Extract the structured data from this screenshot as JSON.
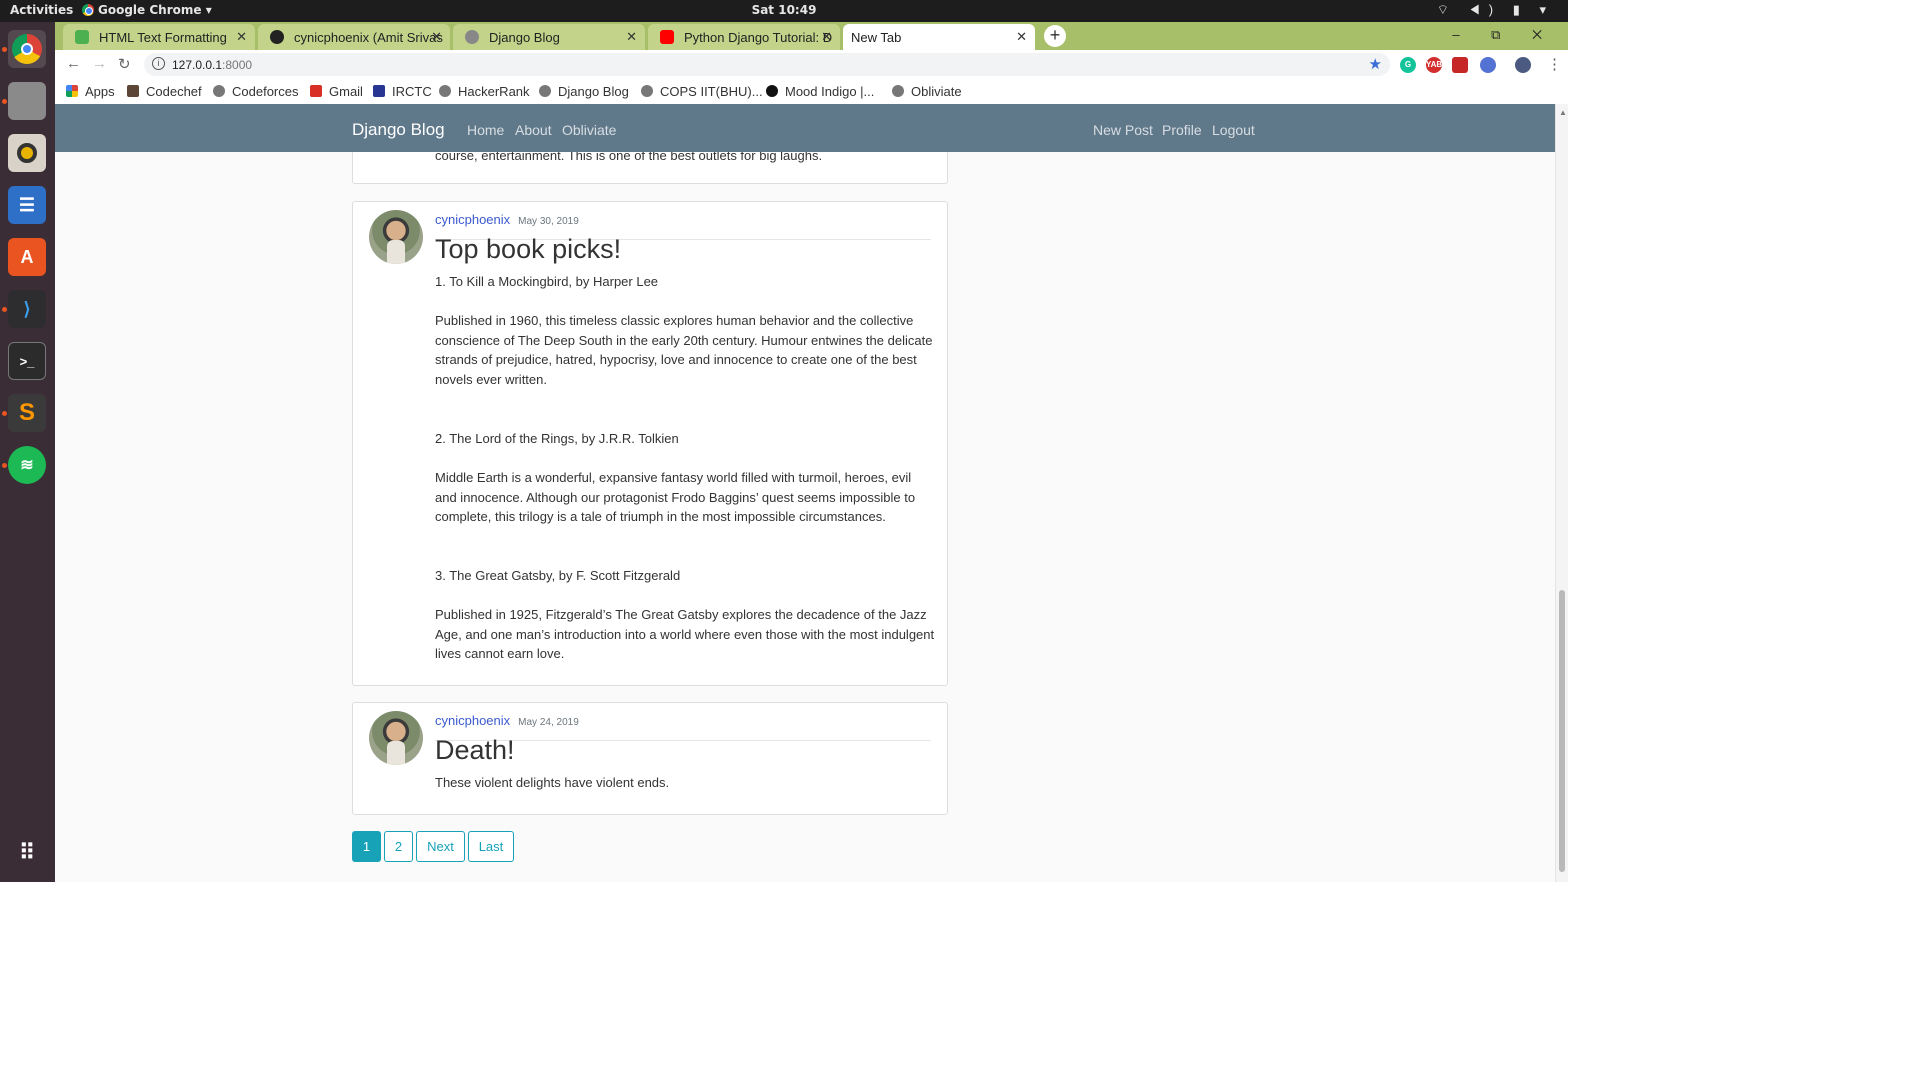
{
  "os": {
    "activities": "Activities",
    "app_name": "Google Chrome ▾",
    "clock": "Sat 10:49",
    "tray": "⌔ ◀) ▮ ▾"
  },
  "browser": {
    "tabs": [
      {
        "title": "HTML Text Formatting",
        "close": "✕",
        "favicon_color": "#4caf50"
      },
      {
        "title": "cynicphoenix (Amit Srivas",
        "close": "✕",
        "favicon_color": "#222222"
      },
      {
        "title": "Django Blog",
        "close": "✕",
        "favicon_color": "#888888"
      },
      {
        "title": "Python Django Tutorial: D",
        "close": "✕",
        "favicon_color": "#ff0000"
      },
      {
        "title": "New Tab",
        "close": "✕",
        "favicon_color": ""
      }
    ],
    "new_tab": "+",
    "window_controls": "– ⧉ ✕",
    "back": "←",
    "forward": "→",
    "reload": "↻",
    "info": "i",
    "url_host": "127.0.0.1",
    "url_port": ":8000",
    "star": "★",
    "bookmarks": [
      {
        "label": "Apps"
      },
      {
        "label": "Codechef"
      },
      {
        "label": "Codeforces"
      },
      {
        "label": "Gmail"
      },
      {
        "label": "IRCTC"
      },
      {
        "label": "HackerRank"
      },
      {
        "label": "Django Blog"
      },
      {
        "label": "COPS IIT(BHU)..."
      },
      {
        "label": "Mood Indigo |..."
      },
      {
        "label": "Obliviate"
      }
    ],
    "extensions": [
      "G",
      "YAB",
      "",
      "",
      ""
    ]
  },
  "site": {
    "brand": "Django Blog",
    "nav_left": [
      "Home",
      "About",
      "Obliviate"
    ],
    "nav_right": [
      "New Post",
      "Profile",
      "Logout"
    ]
  },
  "posts": [
    {
      "partial_text": "course, entertainment. This is one of the best outlets for big laughs."
    },
    {
      "author": "cynicphoenix",
      "date": "May 30, 2019",
      "title": "Top book picks!",
      "paragraphs": [
        "1. To Kill a Mockingbird, by Harper Lee",
        "Published in 1960, this timeless classic explores human behavior and the collective conscience of The Deep South in the early 20th century. Humour entwines the delicate strands of prejudice, hatred, hypocrisy, love and innocence to create one of the best novels ever written.",
        "2. The Lord of the Rings, by J.R.R. Tolkien",
        "Middle Earth is a wonderful, expansive fantasy world filled with turmoil, heroes, evil and innocence. Although our protagonist Frodo Baggins’ quest seems impossible to complete, this trilogy is a tale of triumph in the most impossible circumstances.",
        "3. The Great Gatsby, by F. Scott Fitzgerald",
        "Published in 1925, Fitzgerald’s The Great Gatsby explores the decadence of the Jazz Age, and one man’s introduction into a world where even those with the most indulgent lives cannot earn love."
      ]
    },
    {
      "author": "cynicphoenix",
      "date": "May 24, 2019",
      "title": "Death!",
      "body": "These violent delights have violent ends."
    }
  ],
  "pagination": [
    "1",
    "2",
    "Next",
    "Last"
  ],
  "colors": {
    "navbar": "#5f788a",
    "tabstrip": "#a8bf6a",
    "pager": "#17a2b8",
    "author_link": "#3b5bcf"
  }
}
